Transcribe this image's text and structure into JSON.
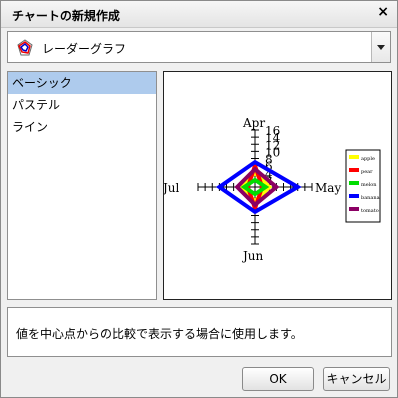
{
  "dialog": {
    "title": "チャートの新規作成",
    "close_glyph": "×"
  },
  "chart_type_combo": {
    "selected": "レーダーグラフ",
    "icon": "radar-chart-icon"
  },
  "style_list": {
    "items": [
      {
        "label": "ベーシック",
        "selected": true
      },
      {
        "label": "パステル",
        "selected": false
      },
      {
        "label": "ライン",
        "selected": false
      }
    ]
  },
  "description": "値を中心点からの比較で表示する場合に使用します。",
  "buttons": {
    "ok": "OK",
    "cancel": "キャンセル"
  },
  "chart_data": {
    "type": "radar",
    "axes": [
      "Apr",
      "May",
      "Jun",
      "Jul"
    ],
    "tick_labels": [
      "16",
      "14",
      "12",
      "10",
      "8",
      "6",
      "4",
      "2"
    ],
    "rmax": 16,
    "series": [
      {
        "name": "apple",
        "color": "#ffff00",
        "values": [
          4,
          4,
          4,
          4
        ]
      },
      {
        "name": "pear",
        "color": "#ff0000",
        "values": [
          6,
          2,
          6,
          2
        ]
      },
      {
        "name": "melon",
        "color": "#00dd00",
        "values": [
          2,
          3,
          2,
          3
        ]
      },
      {
        "name": "banana",
        "color": "#0000ff",
        "values": [
          7,
          12,
          7,
          10
        ]
      },
      {
        "name": "tomato",
        "color": "#8b0064",
        "values": [
          5,
          6,
          5,
          5
        ]
      }
    ]
  }
}
